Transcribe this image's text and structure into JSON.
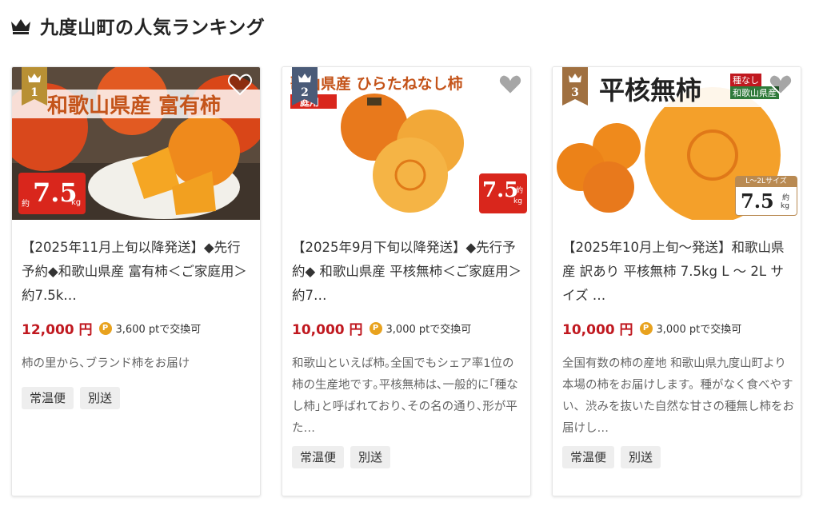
{
  "header": {
    "title": "九度山町の人気ランキング",
    "icon": "crown-icon"
  },
  "colors": {
    "price": "#c0181f",
    "gold": "#b89034",
    "navy": "#4a5b78",
    "bronze": "#a07040",
    "point": "#e8a21e"
  },
  "cards": [
    {
      "rank": "1",
      "image_title": "和歌山県産 富有柿",
      "badge_prefix": "約",
      "badge_value": "7.5",
      "badge_unit": "kg",
      "product_title": "【2025年11月上旬以降発送】◆先行予約◆和歌山県産 富有柿＜ご家庭用＞約7.5k…",
      "price": "12,000 円",
      "points": "3,600 ptで交換可",
      "description": "柿の里から､ブランド柿をお届け",
      "tags": [
        "常温便",
        "別送"
      ]
    },
    {
      "rank": "2",
      "image_title": "歌山県産 ひらたねなし柿",
      "image_subtitle": "庭用",
      "badge_prefix": "約",
      "badge_value": "7.5",
      "badge_unit": "kg",
      "product_title": "【2025年9月下旬以降発送】◆先行予約◆ 和歌山県産 平核無柿＜ご家庭用＞約7…",
      "price": "10,000 円",
      "points": "3,000 ptで交換可",
      "description": "和歌山といえば柿｡全国でもシェア率1位の柿の生産地です｡平核無柿は､一般的に｢種なし柿｣と呼ばれており､その名の通り､形が平た…",
      "tags": [
        "常温便",
        "別送"
      ]
    },
    {
      "rank": "3",
      "image_title": "平核無柿",
      "image_label_1": "種なし",
      "image_label_2": "和歌山県産",
      "badge_size": "L～2Lサイズ",
      "badge_value": "7.5",
      "badge_prefix": "約",
      "badge_unit": "kg",
      "product_title": "【2025年10月上旬～発送】和歌山県産 訳あり 平核無柿 7.5kg L ～ 2L サイズ …",
      "price": "10,000 円",
      "points": "3,000 ptで交換可",
      "description": "全国有数の柿の産地 和歌山県九度山町より本場の柿をお届けします。種がなく食べやすい、渋みを抜いた自然な甘さの種無し柿をお届けし…",
      "tags": [
        "常温便",
        "別送"
      ]
    }
  ]
}
